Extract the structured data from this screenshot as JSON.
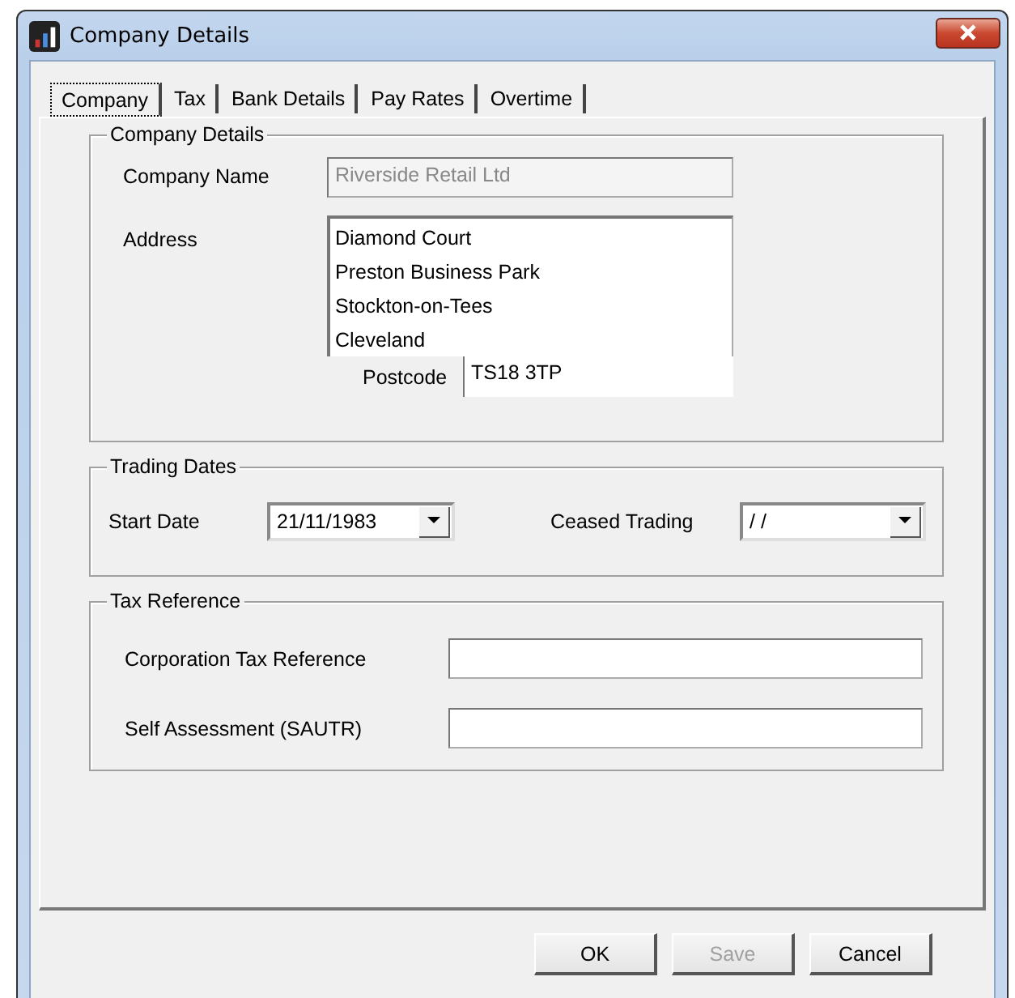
{
  "window": {
    "title": "Company Details"
  },
  "tabs": [
    {
      "label": "Company",
      "selected": true
    },
    {
      "label": "Tax",
      "selected": false
    },
    {
      "label": "Bank Details",
      "selected": false
    },
    {
      "label": "Pay Rates",
      "selected": false
    },
    {
      "label": "Overtime",
      "selected": false
    }
  ],
  "company_details": {
    "title": "Company Details",
    "company_name": {
      "label": "Company Name",
      "value": "Riverside Retail Ltd",
      "disabled": true
    },
    "address": {
      "label": "Address",
      "lines": [
        "Diamond Court",
        "Preston Business Park",
        "Stockton-on-Tees",
        "Cleveland"
      ]
    },
    "postcode": {
      "label": "Postcode",
      "value": "TS18 3TP"
    }
  },
  "trading_dates": {
    "title": "Trading Dates",
    "start_date": {
      "label": "Start Date",
      "value": "21/11/1983"
    },
    "ceased_trading": {
      "label": "Ceased Trading",
      "value": "/ /"
    }
  },
  "tax_reference": {
    "title": "Tax Reference",
    "fields": [
      {
        "label": "Corporation Tax Reference"
      },
      {
        "label": "Self Assessment (SAUTR)"
      }
    ]
  },
  "buttons": [
    {
      "label": "OK",
      "disabled": false
    },
    {
      "label": "Save",
      "disabled": true
    },
    {
      "label": "Cancel",
      "disabled": false
    }
  ]
}
